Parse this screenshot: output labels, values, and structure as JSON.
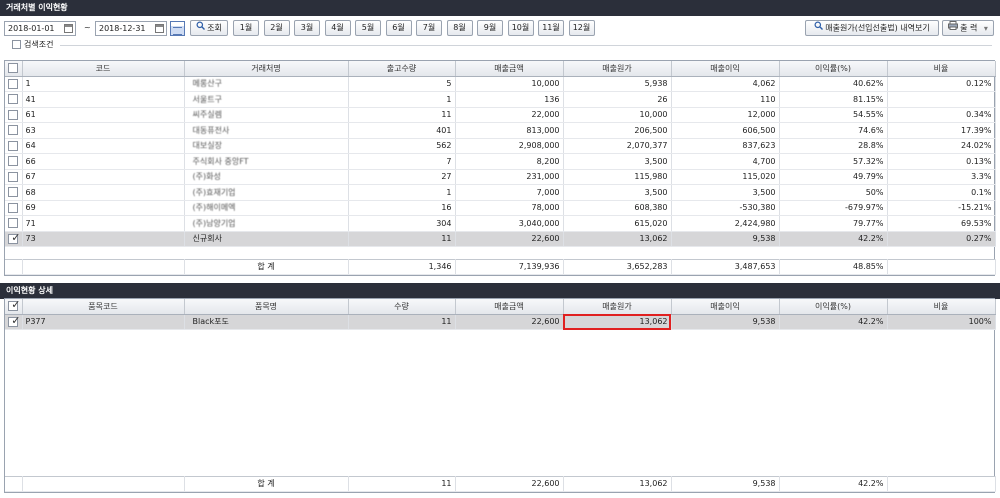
{
  "top_panel": {
    "title": "거래처별 이익현황",
    "start_date": "2018-01-01",
    "tilde": "~",
    "end_date": "2018-12-31",
    "search_button": "조회",
    "months": [
      "1월",
      "2월",
      "3월",
      "4월",
      "5월",
      "6월",
      "7월",
      "8월",
      "9월",
      "10월",
      "11월",
      "12월"
    ],
    "cost_view_button": "매출원가(선입선출법) 내역보기",
    "print_button": "출 력",
    "search_condition_label": "검색조건",
    "columns": [
      "코드",
      "거래처명",
      "출고수량",
      "매출금액",
      "매출원가",
      "매출이익",
      "이익률(%)",
      "비율"
    ],
    "rows": [
      {
        "code": "1",
        "name": "메롱산구",
        "qty": "5",
        "sales": "10,000",
        "cost": "5,938",
        "profit": "4,062",
        "rate": "40.62%",
        "ratio": "0.12%"
      },
      {
        "code": "41",
        "name": "서울트구",
        "qty": "1",
        "sales": "136",
        "cost": "26",
        "profit": "110",
        "rate": "81.15%",
        "ratio": ""
      },
      {
        "code": "61",
        "name": "씨주실렘",
        "qty": "11",
        "sales": "22,000",
        "cost": "10,000",
        "profit": "12,000",
        "rate": "54.55%",
        "ratio": "0.34%"
      },
      {
        "code": "63",
        "name": "대동퓨전사",
        "qty": "401",
        "sales": "813,000",
        "cost": "206,500",
        "profit": "606,500",
        "rate": "74.6%",
        "ratio": "17.39%"
      },
      {
        "code": "64",
        "name": "대보실장",
        "qty": "562",
        "sales": "2,908,000",
        "cost": "2,070,377",
        "profit": "837,623",
        "rate": "28.8%",
        "ratio": "24.02%"
      },
      {
        "code": "66",
        "name": "주식회사 중앙FT",
        "qty": "7",
        "sales": "8,200",
        "cost": "3,500",
        "profit": "4,700",
        "rate": "57.32%",
        "ratio": "0.13%"
      },
      {
        "code": "67",
        "name": "(주)화성",
        "qty": "27",
        "sales": "231,000",
        "cost": "115,980",
        "profit": "115,020",
        "rate": "49.79%",
        "ratio": "3.3%"
      },
      {
        "code": "68",
        "name": "(주)효재기업",
        "qty": "1",
        "sales": "7,000",
        "cost": "3,500",
        "profit": "3,500",
        "rate": "50%",
        "ratio": "0.1%"
      },
      {
        "code": "69",
        "name": "(주)해이메엑",
        "qty": "16",
        "sales": "78,000",
        "cost": "608,380",
        "profit": "-530,380",
        "rate": "-679.97%",
        "ratio": "-15.21%"
      },
      {
        "code": "71",
        "name": "(주)남양기업",
        "qty": "304",
        "sales": "3,040,000",
        "cost": "615,020",
        "profit": "2,424,980",
        "rate": "79.77%",
        "ratio": "69.53%"
      },
      {
        "code": "73",
        "name": "신규회사",
        "qty": "11",
        "sales": "22,600",
        "cost": "13,062",
        "profit": "9,538",
        "rate": "42.2%",
        "ratio": "0.27%",
        "selected": true
      }
    ],
    "summary": {
      "label": "합    계",
      "qty": "1,346",
      "sales": "7,139,936",
      "cost": "3,652,283",
      "profit": "3,487,653",
      "rate": "48.85%"
    }
  },
  "bottom_panel": {
    "title": "이익현황 상세",
    "columns": [
      "품목코드",
      "품목명",
      "수량",
      "매출금액",
      "매출원가",
      "매출이익",
      "이익률(%)",
      "비율"
    ],
    "rows": [
      {
        "code": "P377",
        "name": "Black포도",
        "qty": "11",
        "sales": "22,600",
        "cost": "13,062",
        "profit": "9,538",
        "rate": "42.2%",
        "ratio": "100%"
      }
    ],
    "summary": {
      "label": "합    계",
      "qty": "11",
      "sales": "22,600",
      "cost": "13,062",
      "profit": "9,538",
      "rate": "42.2%"
    }
  },
  "colors": {
    "title_bar": "#2b2f3a",
    "selected_row": "#d6d6d8",
    "highlight_border": "#e02020"
  }
}
